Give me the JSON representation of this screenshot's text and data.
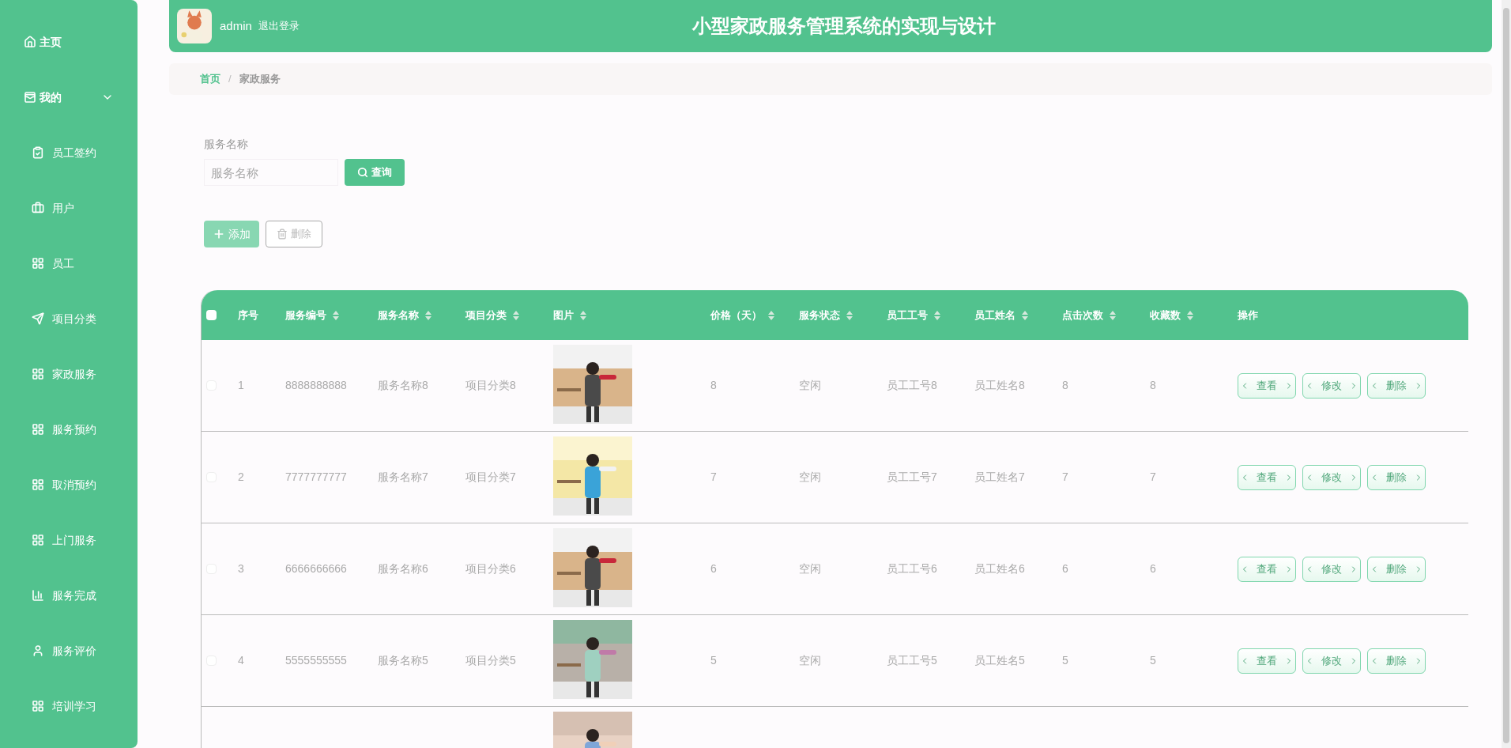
{
  "sidebar": {
    "items": [
      {
        "label": "主页",
        "kind": "home"
      },
      {
        "label": "我的",
        "kind": "wallet",
        "expanded": true,
        "children": [
          {
            "label": "员工签约",
            "kind": "clipboard"
          },
          {
            "label": "用户",
            "kind": "briefcase"
          },
          {
            "label": "员工",
            "kind": "grid"
          },
          {
            "label": "项目分类",
            "kind": "send"
          },
          {
            "label": "家政服务",
            "kind": "grid"
          },
          {
            "label": "服务预约",
            "kind": "grid"
          },
          {
            "label": "取消预约",
            "kind": "grid"
          },
          {
            "label": "上门服务",
            "kind": "grid"
          },
          {
            "label": "服务完成",
            "kind": "chart"
          },
          {
            "label": "服务评价",
            "kind": "user"
          },
          {
            "label": "培训学习",
            "kind": "grid"
          }
        ]
      }
    ]
  },
  "header": {
    "username": "admin",
    "logout": "退出登录",
    "title": "小型家政服务管理系统的实现与设计",
    "avatar": {
      "kind": "picture"
    }
  },
  "breadcrumb": [
    {
      "label": "首页",
      "selected": false
    },
    {
      "label": "家政服务",
      "selected": true
    }
  ],
  "breadcrumb_separator": "/",
  "search": {
    "label": "服务名称",
    "placeholder": "服务名称",
    "button": "查询"
  },
  "actions": [
    {
      "label": "添加",
      "kind": "add"
    },
    {
      "label": "删除",
      "kind": "delete"
    }
  ],
  "table": {
    "select_all": {
      "checked": false
    },
    "columns": [
      {
        "label": "序号",
        "sortable": false
      },
      {
        "label": "服务编号",
        "sortable": true
      },
      {
        "label": "服务名称",
        "sortable": true
      },
      {
        "label": "项目分类",
        "sortable": true
      },
      {
        "label": "图片",
        "sortable": true
      },
      {
        "label": "价格（天）",
        "sortable": true
      },
      {
        "label": "服务状态",
        "sortable": true
      },
      {
        "label": "员工工号",
        "sortable": true
      },
      {
        "label": "员工姓名",
        "sortable": true
      },
      {
        "label": "点击次数",
        "sortable": true
      },
      {
        "label": "收藏数",
        "sortable": true
      },
      {
        "label": "操作",
        "sortable": false
      }
    ],
    "rows": [
      {
        "checked": false,
        "cells": [
          "1",
          "8888888888",
          "服务名称8",
          "项目分类8"
        ],
        "image": {
          "kind": "picture"
        },
        "rest": [
          "8",
          "空闲",
          "员工工号8",
          "员工姓名8",
          "8",
          "8"
        ],
        "buttons": [
          "查看",
          "修改",
          "删除"
        ]
      },
      {
        "checked": false,
        "cells": [
          "2",
          "7777777777",
          "服务名称7",
          "项目分类7"
        ],
        "image": {
          "kind": "picture"
        },
        "rest": [
          "7",
          "空闲",
          "员工工号7",
          "员工姓名7",
          "7",
          "7"
        ],
        "buttons": [
          "查看",
          "修改",
          "删除"
        ]
      },
      {
        "checked": false,
        "cells": [
          "3",
          "6666666666",
          "服务名称6",
          "项目分类6"
        ],
        "image": {
          "kind": "picture"
        },
        "rest": [
          "6",
          "空闲",
          "员工工号6",
          "员工姓名6",
          "6",
          "6"
        ],
        "buttons": [
          "查看",
          "修改",
          "删除"
        ]
      },
      {
        "checked": false,
        "cells": [
          "4",
          "5555555555",
          "服务名称5",
          "项目分类5"
        ],
        "image": {
          "kind": "picture"
        },
        "rest": [
          "5",
          "空闲",
          "员工工号5",
          "员工姓名5",
          "5",
          "5"
        ],
        "buttons": [
          "查看",
          "修改",
          "删除"
        ]
      },
      {
        "checked": null,
        "cells": [],
        "image": {
          "kind": "picture"
        },
        "rest": [],
        "buttons": []
      }
    ]
  }
}
